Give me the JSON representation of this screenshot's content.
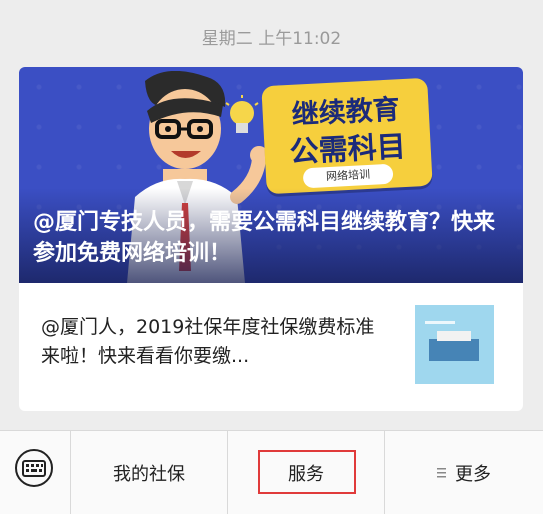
{
  "timestamp": "星期二 上午11:02",
  "article_main": {
    "headline": "@厦门专技人员，需要公需科目继续教育？快来参加免费网络培训！",
    "banner_sign_line1": "继续教育",
    "banner_sign_line2": "公需科目",
    "banner_tag": "网络培训"
  },
  "article_second": {
    "title": "@厦门人，2019社保年度社保缴费标准来啦！快来看看你要缴..."
  },
  "bottom_menu": {
    "item1": "我的社保",
    "item2": "服务",
    "item3": "更多"
  },
  "colors": {
    "banner_blue": "#3b4fc4",
    "sign_yellow": "#f6cf3d",
    "highlight_red": "#e03a3a"
  }
}
